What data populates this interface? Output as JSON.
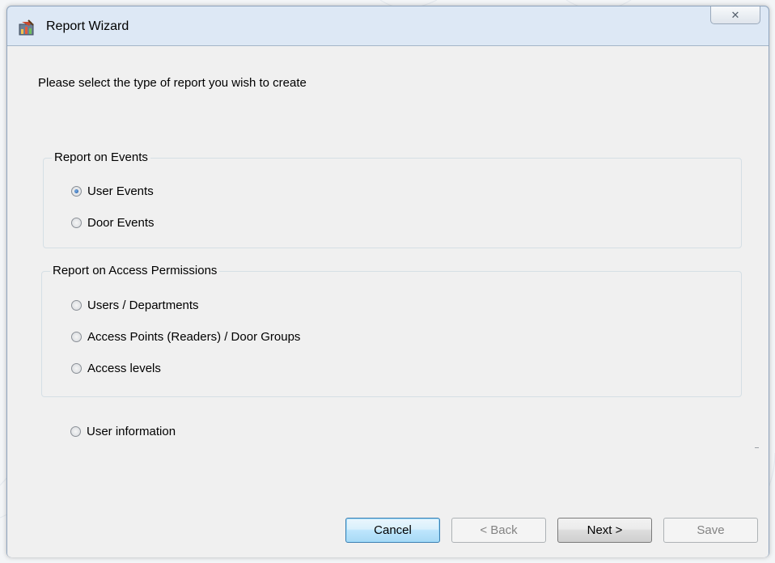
{
  "window": {
    "title": "Report Wizard",
    "close_glyph": "✕",
    "app_icon": "report-wizard-icon"
  },
  "instruction": "Please select the type of report you wish to create",
  "events_group": {
    "label": "Report on Events",
    "options": [
      "User Events",
      "Door Events"
    ],
    "selected": "User Events"
  },
  "permissions_group": {
    "label": "Report on Access Permissions",
    "options": [
      "Users / Departments",
      "Access Points (Readers) / Door Groups",
      "Access levels"
    ]
  },
  "user_information": "User information",
  "buttons": {
    "cancel": "Cancel",
    "back": "< Back",
    "next": "Next >",
    "save": "Save"
  },
  "colors": {
    "default_button": "#bee6fd",
    "window_frame": "#dde8f5"
  }
}
